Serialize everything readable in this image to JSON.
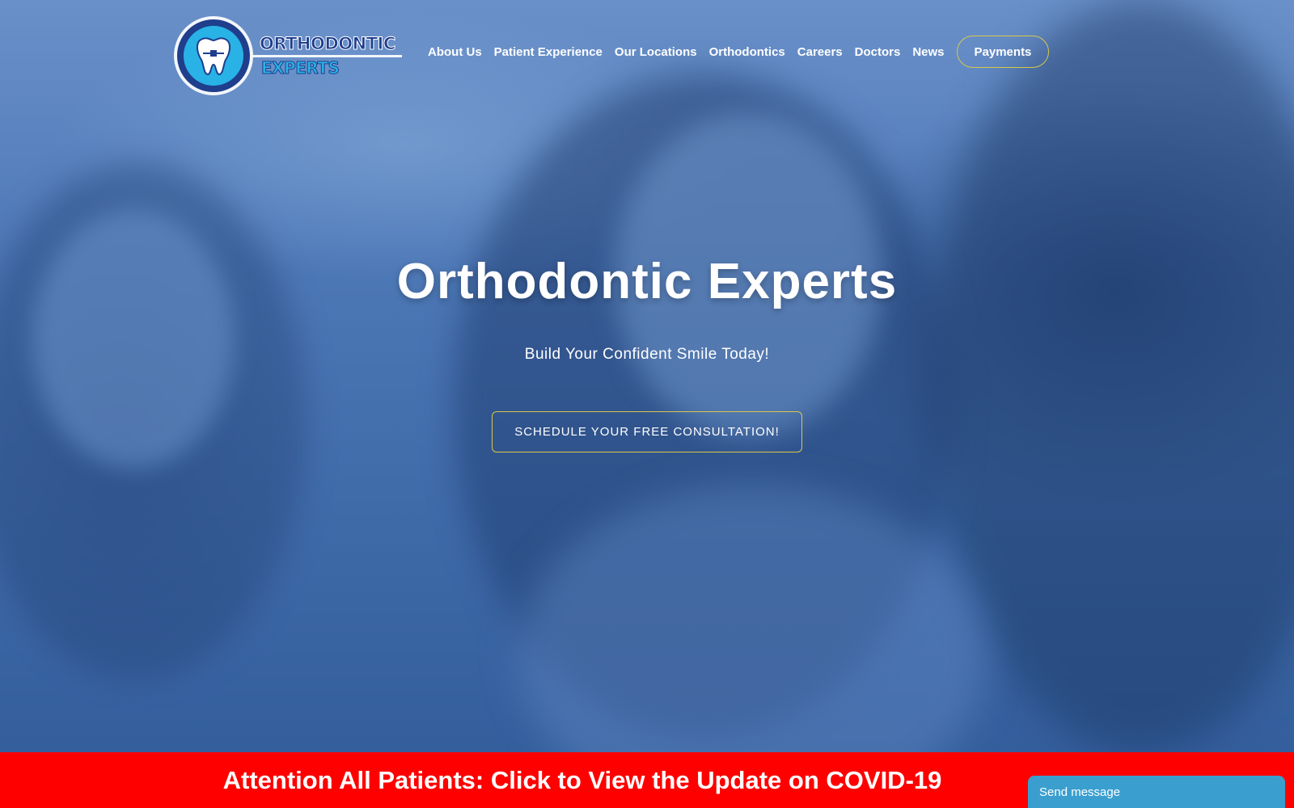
{
  "brand": {
    "logo_line_1": "ORTHODONTIC",
    "logo_line_2": "EXPERTS"
  },
  "nav": {
    "items": [
      {
        "label": "About Us"
      },
      {
        "label": "Patient Experience"
      },
      {
        "label": "Our Locations"
      },
      {
        "label": "Orthodontics"
      },
      {
        "label": "Careers"
      },
      {
        "label": "Doctors"
      },
      {
        "label": "News"
      }
    ],
    "payments_label": "Payments"
  },
  "hero": {
    "title": "Orthodontic Experts",
    "subtitle": "Build Your Confident Smile Today!",
    "cta_label": "SCHEDULE YOUR FREE CONSULTATION!"
  },
  "banner": {
    "text": "Attention All Patients: Click to View the Update on COVID-19"
  },
  "chat": {
    "label": "Send message"
  },
  "colors": {
    "hero_overlay": "#4a74b0",
    "banner": "#ff0000",
    "button_border": "#d8c84a",
    "chat": "#3a9fcf",
    "logo_navy": "#1f3e8c",
    "logo_cyan": "#29b2e6"
  }
}
